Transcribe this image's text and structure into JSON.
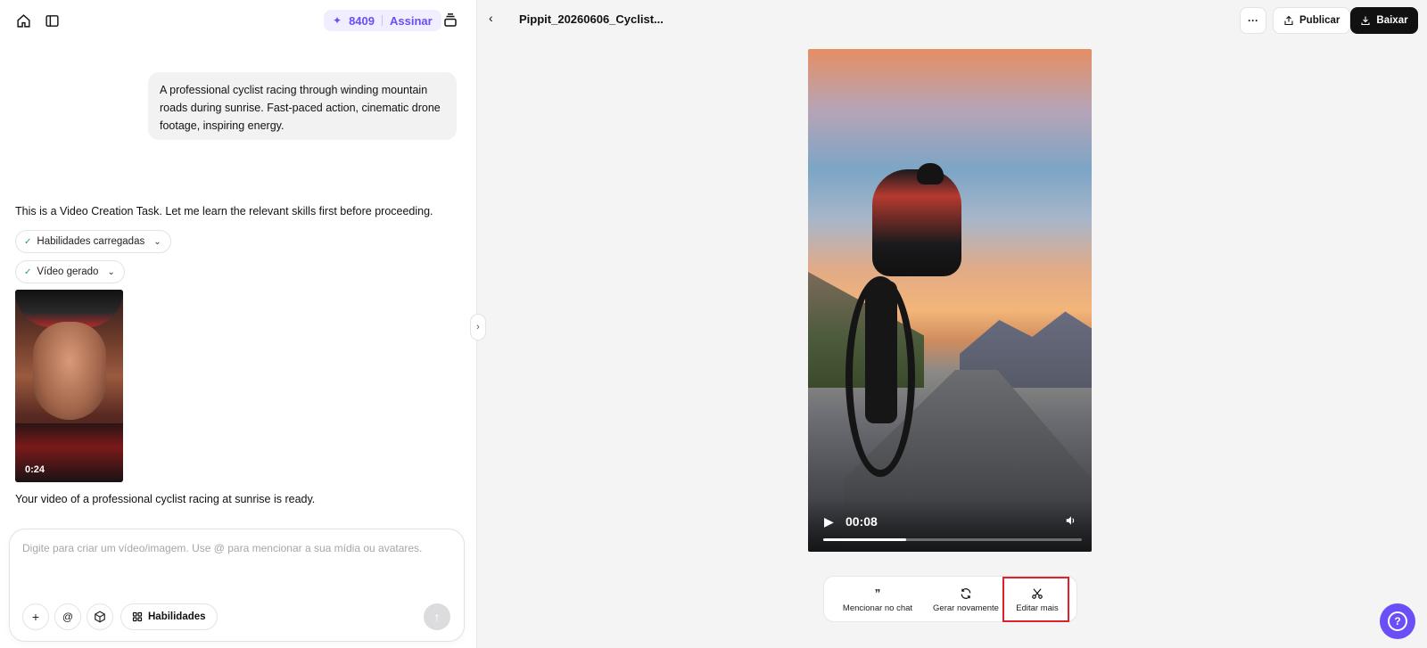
{
  "sidebar": {
    "credits": "8409",
    "subscribe_label": "Assinar",
    "user_prompt": "A professional cyclist racing through winding mountain roads during sunrise. Fast-paced action, cinematic drone footage, inspiring energy.",
    "assistant_intro": "This is a Video Creation Task. Let me learn the relevant skills first before proceeding.",
    "pill_skills": "Habilidades carregadas",
    "pill_video": "Vídeo gerado",
    "thumb_duration": "0:24",
    "ready_text": "Your video of a professional cyclist racing at sunrise is ready.",
    "input_placeholder": "Digite para criar um vídeo/imagem. Use @ para mencionar a sua mídia ou avatares.",
    "skills_button": "Habilidades"
  },
  "header": {
    "title": "Pippit_20260606_Cyclist...",
    "publish_label": "Publicar",
    "download_label": "Baixar"
  },
  "player": {
    "current_time": "00:08",
    "progress": 0.32
  },
  "actions": {
    "mention_label": "Mencionar no chat",
    "regenerate_label": "Gerar novamente",
    "edit_label": "Editar mais"
  },
  "colors": {
    "accent": "#6b4ef5",
    "highlight": "#e0202a"
  }
}
